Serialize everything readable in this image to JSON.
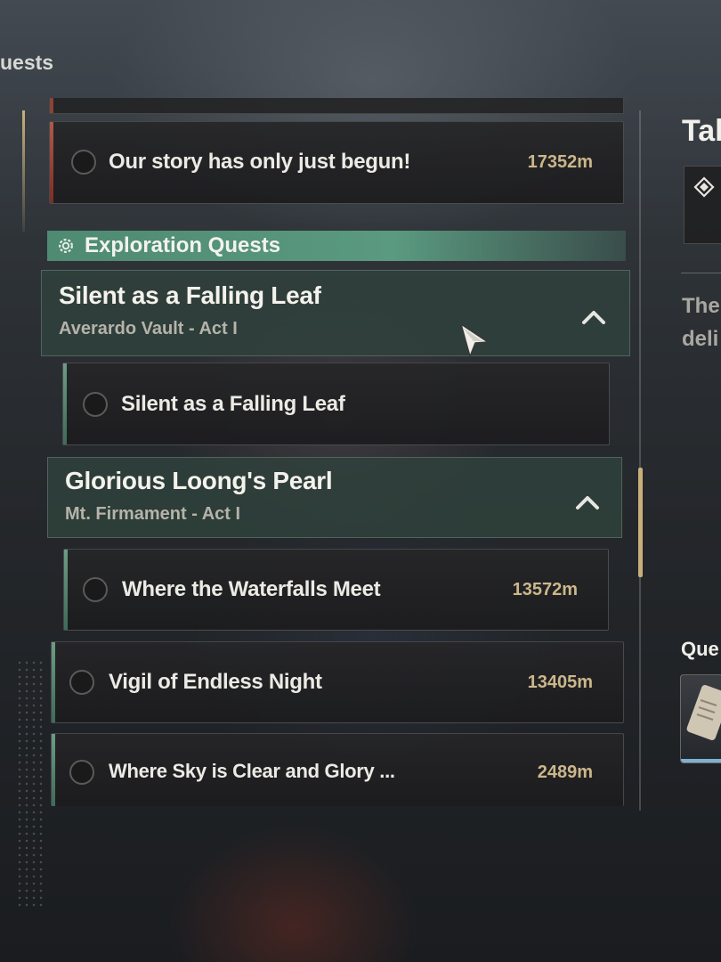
{
  "header": {
    "title": "uests"
  },
  "previous_quest": {
    "name": "Our story has only just begun!",
    "distance": "17352m"
  },
  "section": {
    "label": "Exploration Quests",
    "icon": "gear-icon"
  },
  "groups": [
    {
      "title": "Silent as a Falling Leaf",
      "subtitle": "Averardo Vault - Act I",
      "quests": [
        {
          "name": "Silent as a Falling Leaf",
          "distance": ""
        }
      ]
    },
    {
      "title": "Glorious Loong's Pearl",
      "subtitle": "Mt. Firmament - Act I",
      "quests": [
        {
          "name": "Where the Waterfalls Meet",
          "distance": "13572m"
        }
      ]
    }
  ],
  "quests": [
    {
      "name": "Vigil of Endless Night",
      "distance": "13405m"
    },
    {
      "name": "Where Sky is Clear and Glory ...",
      "distance": "2489m"
    }
  ],
  "right_panel": {
    "title": "Tal",
    "desc_line1": "The",
    "desc_line2": "deli",
    "quest_label": "Que",
    "item_icon": "scroll-icon",
    "diamond_icon": "diamond-icon"
  },
  "colors": {
    "accent_green": "#5a9a80",
    "accent_gold": "#c9b07a",
    "distance_text": "#cbb78a",
    "tracked_red": "#b0584a"
  }
}
